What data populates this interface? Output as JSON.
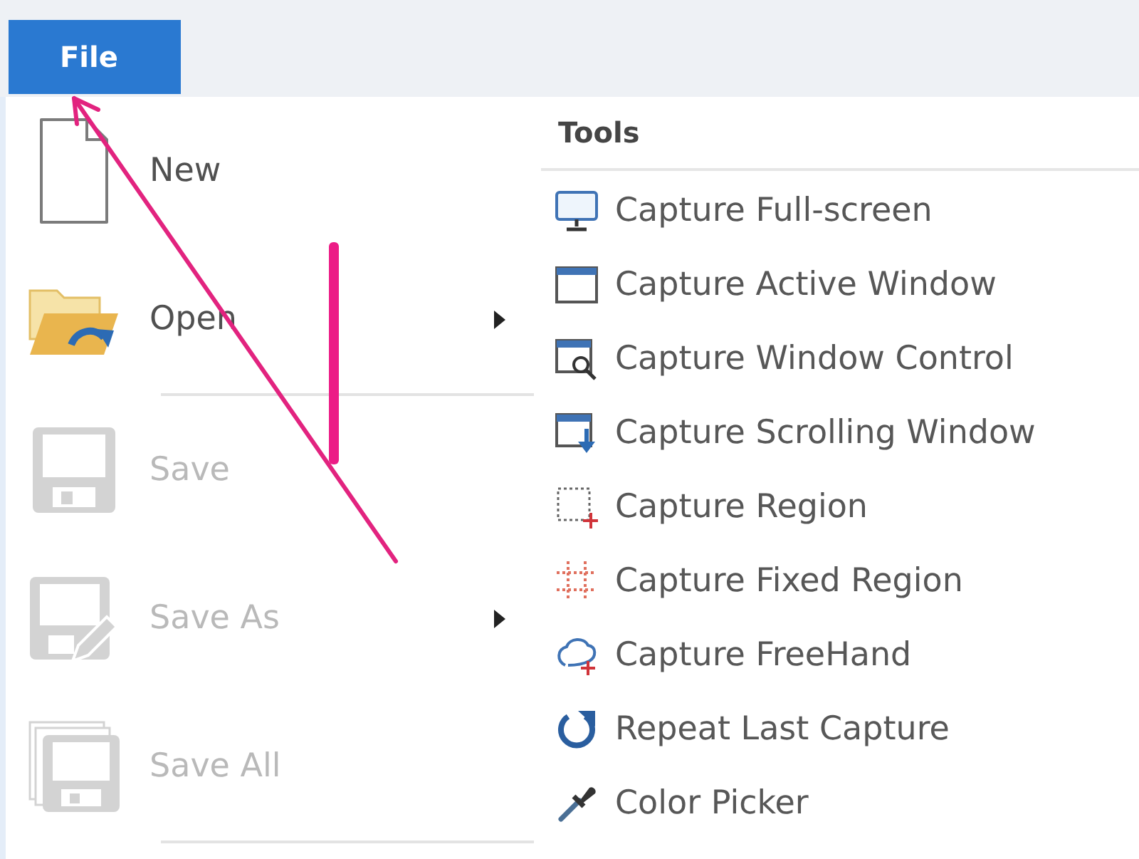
{
  "menu_bar": {
    "tabs": [
      {
        "label": "File",
        "selected": true
      }
    ]
  },
  "file_menu": {
    "items": [
      {
        "kind": "command",
        "label": "New",
        "disabled": false,
        "has_submenu": false
      },
      {
        "kind": "command",
        "label": "Open",
        "disabled": false,
        "has_submenu": true
      },
      {
        "kind": "separator"
      },
      {
        "kind": "command",
        "label": "Save",
        "disabled": true,
        "has_submenu": false
      },
      {
        "kind": "command",
        "label": "Save As",
        "disabled": true,
        "has_submenu": true
      },
      {
        "kind": "command",
        "label": "Save All",
        "disabled": true,
        "has_submenu": false
      },
      {
        "kind": "separator"
      }
    ]
  },
  "tools_panel": {
    "title": "Tools",
    "items": [
      {
        "label": "Capture Full-screen"
      },
      {
        "label": "Capture Active Window"
      },
      {
        "label": "Capture Window Control"
      },
      {
        "label": "Capture Scrolling Window"
      },
      {
        "label": "Capture Region"
      },
      {
        "label": "Capture Fixed Region"
      },
      {
        "label": "Capture FreeHand"
      },
      {
        "label": "Repeat Last Capture"
      },
      {
        "label": "Color Picker"
      }
    ]
  }
}
